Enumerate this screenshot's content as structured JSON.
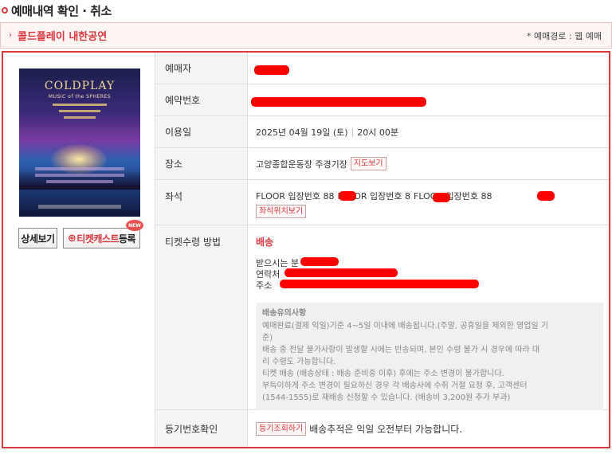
{
  "page": {
    "title": "예매내역 확인 · 취소"
  },
  "performance": {
    "name": "콜드플레이 내한공연",
    "route": "* 예매경로 : 웹 예매"
  },
  "poster": {
    "title": "COLDPLAY",
    "subtitle": "MUSIC of the SPHERES",
    "alt": "Coldplay Music of the Spheres world tour poster"
  },
  "buttons": {
    "detail": "상세보기",
    "ticketcast_prefix": "티켓캐스트",
    "ticketcast_suffix": "등록",
    "new_badge": "NEW"
  },
  "rows": {
    "booker": {
      "label": "예매자",
      "value": ""
    },
    "reservation_no": {
      "label": "예약번호",
      "value": ""
    },
    "use_date": {
      "label": "이용일",
      "date": "2025년 04월 19일 (토)",
      "separator": "|",
      "time": "20시 00분"
    },
    "venue": {
      "label": "장소",
      "value": "고양종합운동장 주경기장",
      "map_button": "지도보기"
    },
    "seat": {
      "label": "좌석",
      "items": [
        "FLOOR 입장번호 88",
        "FLOOR 입장번호 8",
        "FLOOR 입장번호 88"
      ],
      "seat_button": "좌석위치보기"
    },
    "receipt": {
      "label": "티켓수령 방법",
      "method": "배송",
      "recipient_label": "받으시는 분",
      "contact_label": "연락처",
      "address_label": "주소",
      "notice_title": "배송유의사항",
      "notice_lines": [
        "예매완료(결제 익일)기준 4~5일 이내에 배송됩니다.(주말, 공휴일을 제외한 영업일 기",
        "준)",
        "배송 중 전달 불가사항이 발생할 시에는 반송되며, 본인 수령 불가 시 경우에 따라 대",
        "리 수령도 가능합니다.",
        "티켓 배송 (배송상태 : 배송 준비중 이후) 후에는 주소 변경이 불가합니다.",
        "부득이하게 주소 변경이 필요하신 경우 각 배송사에 수취 거절 요청 후, 고객센터",
        "(1544-1555)로 재배송 신청할 수 있습니다. (배송비 3,200원 추가 부과)"
      ]
    },
    "registered_mail": {
      "label": "등기번호확인",
      "button": "등기조회하기",
      "value": "배송추적은 익일 오전부터 가능합니다."
    }
  }
}
